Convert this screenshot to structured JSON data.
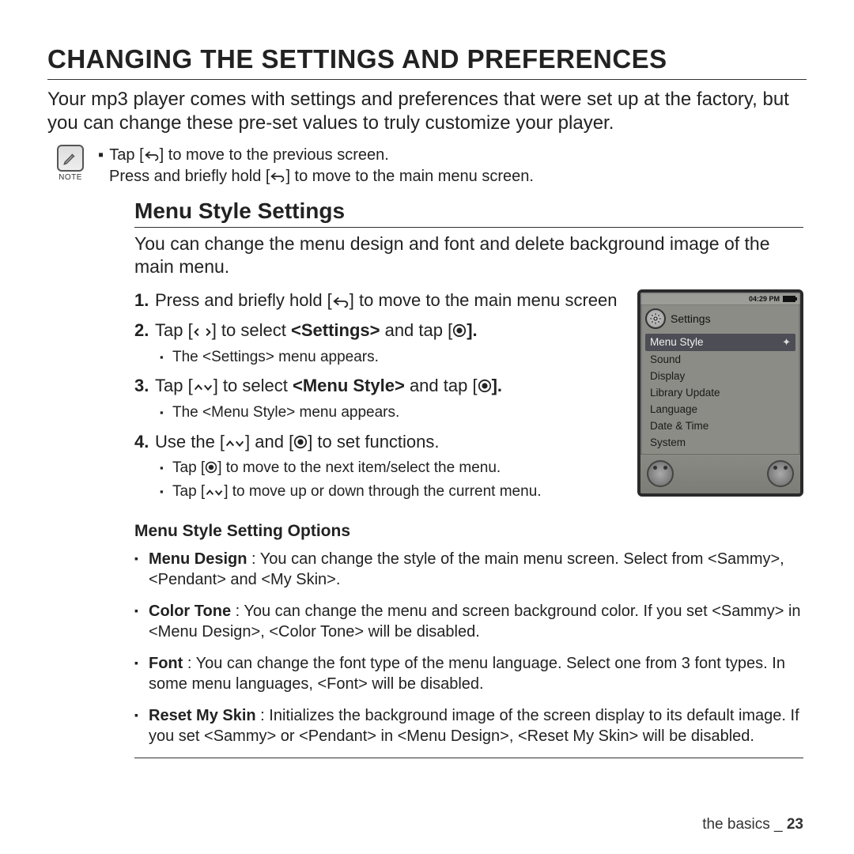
{
  "heading": "CHANGING THE SETTINGS AND PREFERENCES",
  "intro": "Your mp3 player comes with settings and preferences that were set up at the factory, but you can change these pre-set values to truly customize your player.",
  "note": {
    "label": "NOTE",
    "line1_a": "Tap [",
    "line1_b": "] to move to the previous screen.",
    "line2_a": "Press and briefly hold [",
    "line2_b": "] to move to the main menu screen."
  },
  "section": {
    "title": "Menu Style Settings",
    "desc": "You can change the menu design and font and delete background image of the main menu."
  },
  "steps": {
    "s1_a": "Press and briefly hold [",
    "s1_b": "] to move to the main menu screen",
    "s2_a": "Tap [",
    "s2_b": "] to select ",
    "s2_bold": "<Settings>",
    "s2_c": " and tap [",
    "s2_d": "].",
    "s2_sub": "The <Settings> menu appears.",
    "s3_a": "Tap [",
    "s3_b": "] to select ",
    "s3_bold": "<Menu Style>",
    "s3_c": " and tap [",
    "s3_d": "].",
    "s3_sub": "The <Menu Style> menu appears.",
    "s4_a": "Use the [",
    "s4_b": "] and [",
    "s4_c": "] to set functions.",
    "s4_sub1_a": "Tap [",
    "s4_sub1_b": "] to move to the next item/select the menu.",
    "s4_sub2_a": "Tap [",
    "s4_sub2_b": "] to move up or down through the current menu."
  },
  "device": {
    "time": "04:29 PM",
    "title": "Settings",
    "items": [
      "Menu Style",
      "Sound",
      "Display",
      "Library Update",
      "Language",
      "Date & Time",
      "System"
    ],
    "selected_index": 0
  },
  "options_heading": "Menu Style Setting Options",
  "options": [
    {
      "name": "Menu Design",
      "desc": " : You can change the style of the main menu screen. Select from <Sammy>, <Pendant> and <My Skin>."
    },
    {
      "name": "Color Tone",
      "desc": " : You can change the menu and screen background color. If you set <Sammy> in <Menu Design>, <Color Tone> will be disabled."
    },
    {
      "name": "Font",
      "desc": " : You can change the font type of the menu language. Select one from 3 font types. In some menu languages, <Font> will be disabled."
    },
    {
      "name": "Reset My Skin",
      "desc": " : Initializes the background image of the screen display to its default image. If you set <Sammy> or <Pendant> in <Menu Design>, <Reset My Skin> will be disabled."
    }
  ],
  "footer": {
    "section": "the basics",
    "sep": " _ ",
    "page": "23"
  }
}
